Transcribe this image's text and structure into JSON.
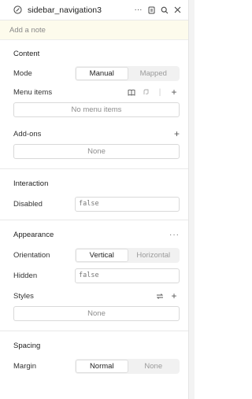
{
  "header": {
    "title": "sidebar_navigation3",
    "icons": [
      "component-icon",
      "more-icon",
      "notes-icon",
      "search-icon",
      "close-icon"
    ]
  },
  "note": {
    "placeholder": "Add a note"
  },
  "content": {
    "title": "Content",
    "mode": {
      "label": "Mode",
      "options": [
        "Manual",
        "Mapped"
      ],
      "selected": "Manual"
    },
    "menu_items": {
      "label": "Menu items",
      "empty": "No menu items"
    },
    "addons": {
      "label": "Add-ons",
      "empty": "None"
    }
  },
  "interaction": {
    "title": "Interaction",
    "disabled": {
      "label": "Disabled",
      "value": "false"
    }
  },
  "appearance": {
    "title": "Appearance",
    "orientation": {
      "label": "Orientation",
      "options": [
        "Vertical",
        "Horizontal"
      ],
      "selected": "Vertical"
    },
    "hidden": {
      "label": "Hidden",
      "value": "false"
    },
    "styles": {
      "label": "Styles",
      "empty": "None"
    }
  },
  "spacing": {
    "title": "Spacing",
    "margin": {
      "label": "Margin",
      "options": [
        "Normal",
        "None"
      ],
      "selected": "Normal"
    }
  }
}
